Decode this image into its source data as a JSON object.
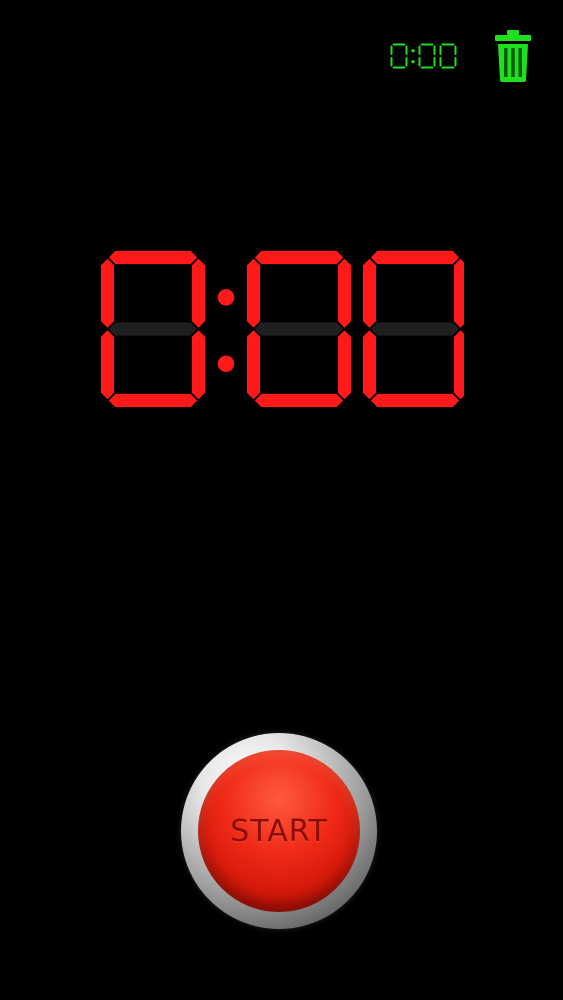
{
  "top_bar": {
    "last_time": "0:00",
    "trash_icon": "trash-can-icon"
  },
  "timer": {
    "display": "0:00",
    "digit_color": "#ff1a1a",
    "unlit_color": "#1f1f1f"
  },
  "start_button": {
    "label": "START",
    "color": "#e8200e"
  },
  "accent_color": "#1fe01f"
}
